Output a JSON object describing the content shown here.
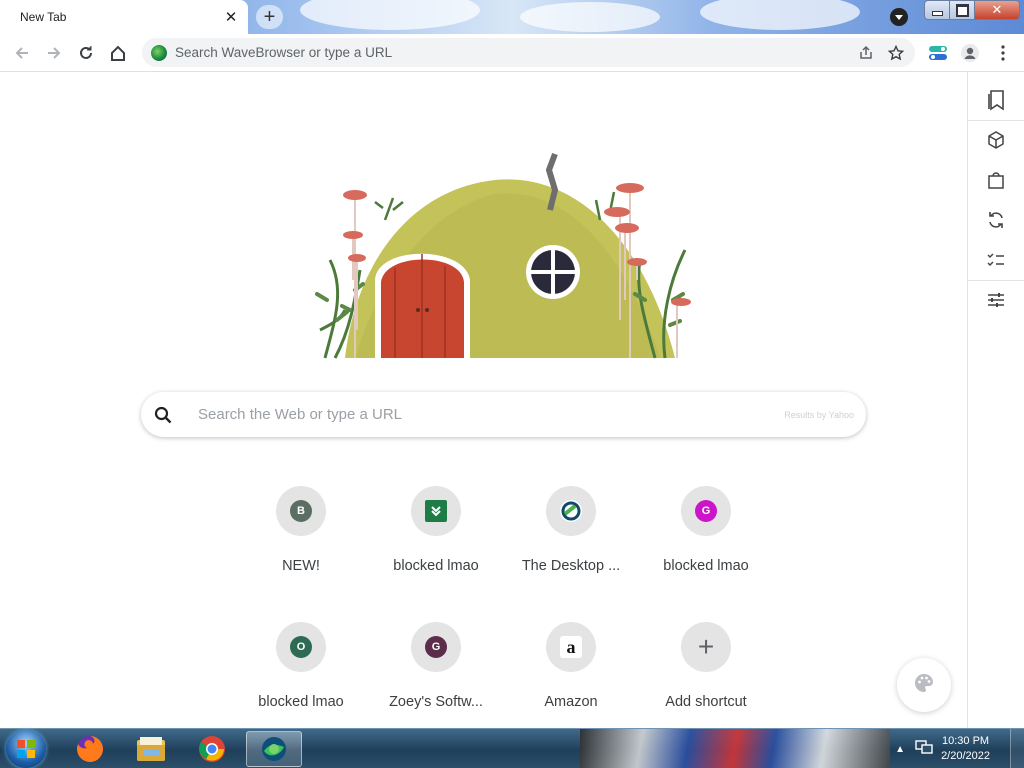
{
  "tab": {
    "title": "New Tab",
    "close_glyph": "✕"
  },
  "new_tab_glyph": "+",
  "toolbar": {
    "omnibox_placeholder": "Search WaveBrowser or type a URL"
  },
  "search": {
    "placeholder": "Search the Web or type a URL",
    "results_by": "Results by Yahoo"
  },
  "shortcuts": [
    {
      "label": "NEW!",
      "letter": "B",
      "color": "#5a6e63"
    },
    {
      "label": "blocked lmao",
      "letter": "",
      "color": "#1e7d46"
    },
    {
      "label": "The Desktop ...",
      "letter": "",
      "color": "#0d4a6e"
    },
    {
      "label": "blocked lmao",
      "letter": "G",
      "color": "#cc15c9"
    },
    {
      "label": "blocked lmao",
      "letter": "O",
      "color": "#2e6b55"
    },
    {
      "label": "Zoey's Softw...",
      "letter": "G",
      "color": "#5b2d4a"
    },
    {
      "label": "Amazon",
      "letter": "a",
      "color": "#ffffff"
    },
    {
      "label": "Add shortcut",
      "letter": "+",
      "color": "#e4e4e4"
    }
  ],
  "side_panel": [
    "bookmarks-icon",
    "package-icon",
    "shopping-bag-icon",
    "refresh-icon",
    "checklist-icon",
    "sliders-icon"
  ],
  "taskbar": {
    "time": "10:30 PM",
    "date": "2/20/2022"
  }
}
